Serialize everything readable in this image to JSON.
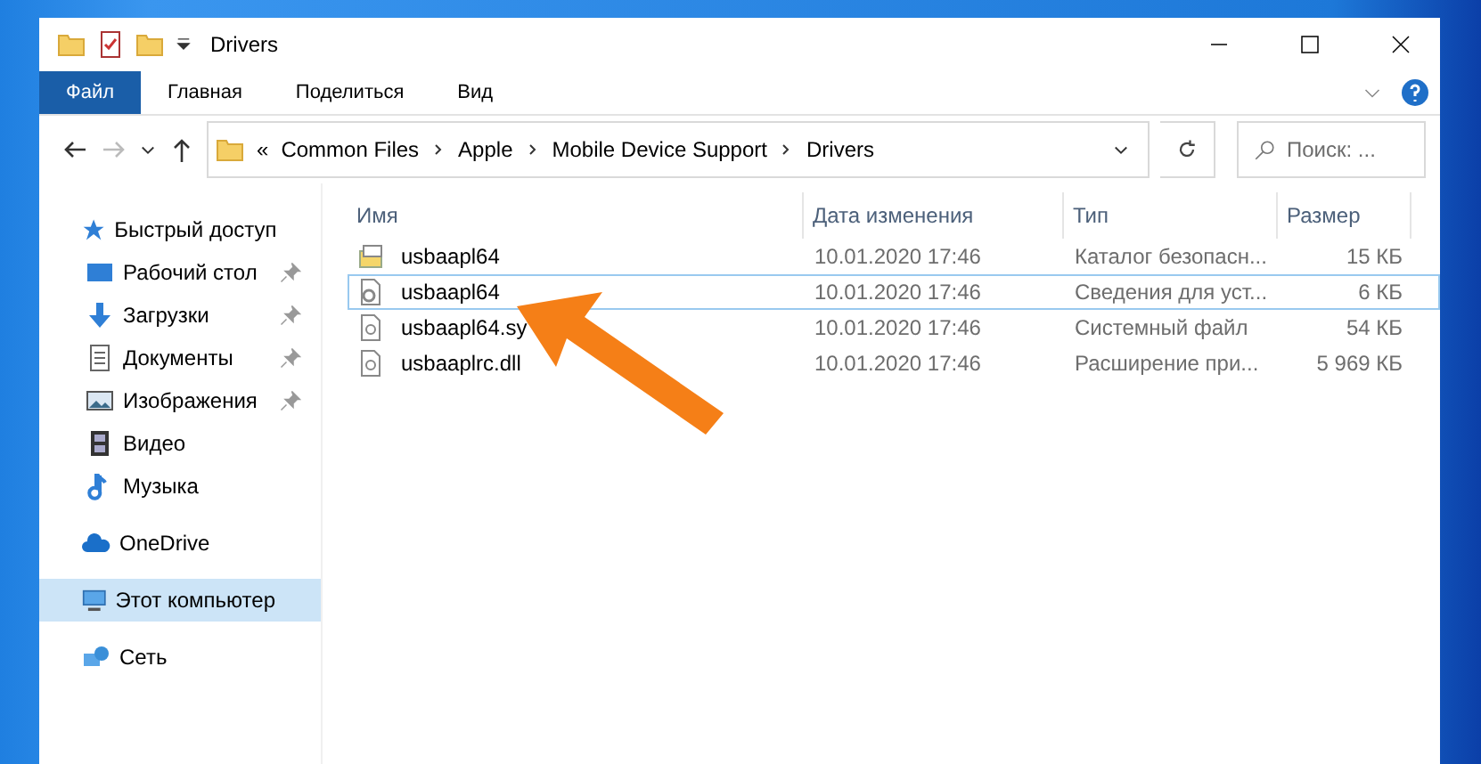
{
  "window": {
    "title": "Drivers"
  },
  "ribbon_tabs": [
    {
      "label": "Файл",
      "selected": true
    },
    {
      "label": "Главная",
      "selected": false
    },
    {
      "label": "Поделиться",
      "selected": false
    },
    {
      "label": "Вид",
      "selected": false
    }
  ],
  "address_bar": {
    "overflow": "«",
    "segments": [
      "Common Files",
      "Apple",
      "Mobile Device Support",
      "Drivers"
    ]
  },
  "search": {
    "placeholder": "Поиск: ..."
  },
  "sidebar": {
    "items": [
      {
        "label": "Быстрый доступ",
        "kind": "star",
        "pinned": false,
        "selected": false,
        "children": [
          {
            "label": "Рабочий стол",
            "kind": "desktop",
            "pinned": true,
            "selected": false
          },
          {
            "label": "Загрузки",
            "kind": "download",
            "pinned": true,
            "selected": false
          },
          {
            "label": "Документы",
            "kind": "document",
            "pinned": true,
            "selected": false
          },
          {
            "label": "Изображения",
            "kind": "image",
            "pinned": true,
            "selected": false
          },
          {
            "label": "Видео",
            "kind": "video",
            "pinned": false,
            "selected": false
          },
          {
            "label": "Музыка",
            "kind": "music",
            "pinned": false,
            "selected": false
          }
        ]
      },
      {
        "label": "OneDrive",
        "kind": "cloud",
        "pinned": false,
        "selected": false
      },
      {
        "label": "Этот компьютер",
        "kind": "computer",
        "pinned": false,
        "selected": true
      },
      {
        "label": "Сеть",
        "kind": "network",
        "pinned": false,
        "selected": false
      }
    ]
  },
  "table": {
    "columns": [
      "Имя",
      "Дата изменения",
      "Тип",
      "Размер"
    ],
    "rows": [
      {
        "kind": "catalog",
        "name": "usbaapl64",
        "date": "10.01.2020 17:46",
        "type": "Каталог безопасн...",
        "size": "15 КБ",
        "selected": false
      },
      {
        "kind": "setup",
        "name": "usbaapl64",
        "date": "10.01.2020 17:46",
        "type": "Сведения для уст...",
        "size": "6 КБ",
        "selected": true
      },
      {
        "kind": "system",
        "name": "usbaapl64.sy",
        "date": "10.01.2020 17:46",
        "type": "Системный файл",
        "size": "54 КБ",
        "selected": false
      },
      {
        "kind": "system",
        "name": "usbaaplrc.dll",
        "date": "10.01.2020 17:46",
        "type": "Расширение при...",
        "size": "5 969 КБ",
        "selected": false
      }
    ]
  }
}
